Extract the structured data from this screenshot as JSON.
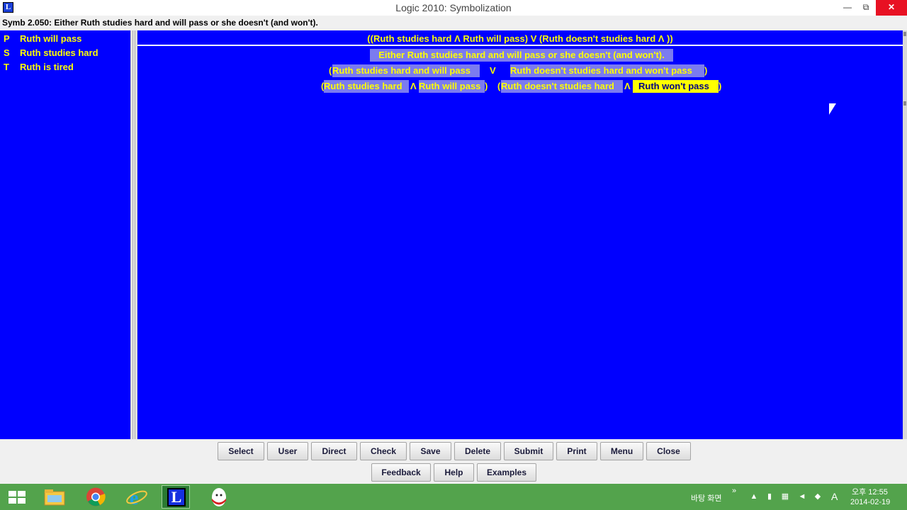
{
  "window": {
    "title": "Logic 2010: Symbolization",
    "icon_letter": "L",
    "minimize": "—",
    "restore": "⧉",
    "close": "✕"
  },
  "problem": "Symb 2.050:  Either Ruth studies hard and will pass or she doesn't (and won't).",
  "sidebar": {
    "items": [
      {
        "key": "P",
        "label": "Ruth will pass"
      },
      {
        "key": "S",
        "label": "Ruth studies hard"
      },
      {
        "key": "T",
        "label": "Ruth is tired"
      }
    ]
  },
  "main": {
    "formula": "((Ruth studies hard  Λ  Ruth will pass)  V  (Ruth doesn't studies hard  Λ      ))",
    "tree": {
      "level1": "Either Ruth studies hard and will pass or she doesn't (and won't).",
      "level2": {
        "lparen": "(",
        "left": "Ruth studies hard and will pass",
        "op": "V",
        "right": "Ruth doesn't studies hard and won't pass",
        "rparen": ")"
      },
      "level3": {
        "lparen1": "(",
        "a": "Ruth studies hard",
        "op1": "Λ",
        "b": "Ruth will pass",
        "rparen1": ")",
        "lparen2": "(",
        "c": "Ruth doesn't studies hard",
        "op2": "Λ",
        "d": "Ruth won't pass",
        "rparen2": ")"
      }
    }
  },
  "buttons": {
    "row1": [
      "Select",
      "User",
      "Direct",
      "Check",
      "Save",
      "Delete",
      "Submit",
      "Print",
      "Menu",
      "Close"
    ],
    "row2": [
      "Feedback",
      "Help",
      "Examples"
    ]
  },
  "taskbar": {
    "apps": [
      "start-icon",
      "file-explorer-icon",
      "chrome-icon",
      "internet-explorer-icon",
      "logic-app-icon",
      "kinder-egg-icon"
    ],
    "logic_letter": "L",
    "desktop_label": "바탕 화면",
    "overflow": "»",
    "ime_indicator": "A",
    "clock_time": "오후 12:55",
    "clock_date": "2014-02-19"
  },
  "colors": {
    "panel_bg": "#0000ff",
    "text_yellow": "#ffff00",
    "highlight": "#7b7bf0",
    "taskbar": "#53a34c",
    "close_red": "#e81123"
  }
}
